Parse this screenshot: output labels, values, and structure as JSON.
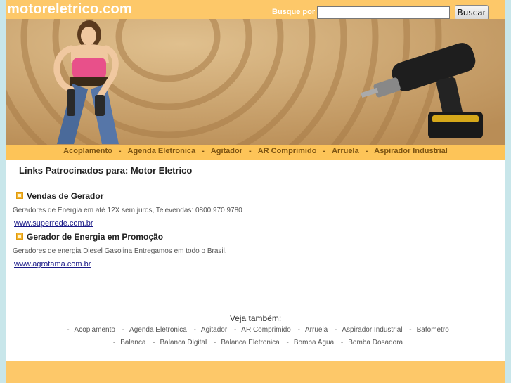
{
  "header": {
    "logo": "motoreletrico.com",
    "search_label": "Busque por",
    "search_value": "",
    "search_button": "Buscar"
  },
  "nav": {
    "items": [
      "Acoplamento",
      "Agenda Eletronica",
      "Agitador",
      "AR Comprimido",
      "Arruela",
      "Aspirador Industrial"
    ]
  },
  "main": {
    "heading": "Links Patrocinados para: Motor Eletrico",
    "ads": [
      {
        "title": "Vendas de Gerador",
        "description": "Geradores de Energia em até 12X sem juros, Televendas: 0800 970 9780",
        "url": "www.superrede.com.br"
      },
      {
        "title": "Gerador de Energia em Promoção",
        "description": "Geradores de energia Diesel Gasolina Entregamos em todo o Brasil.",
        "url": "www.agrotama.com.br"
      }
    ]
  },
  "see_also": {
    "title": "Veja também:",
    "row1": [
      "Acoplamento",
      "Agenda Eletronica",
      "Agitador",
      "AR Comprimido",
      "Arruela",
      "Aspirador Industrial",
      "Bafometro"
    ],
    "row2": [
      "Balanca",
      "Balanca Digital",
      "Balanca Eletronica",
      "Bomba Agua",
      "Bomba Dosadora"
    ]
  },
  "colors": {
    "top_bar": "#fdc869",
    "nav_bar": "#fdc458",
    "nav_text": "#7c5413",
    "banner": "#c8a06d",
    "page_background": "#c8e6ea"
  },
  "icons": {
    "banner_left": "woman-with-drill-illustration",
    "banner_right": "cordless-drill-illustration",
    "ad_bullet": "square-bullet-icon"
  }
}
